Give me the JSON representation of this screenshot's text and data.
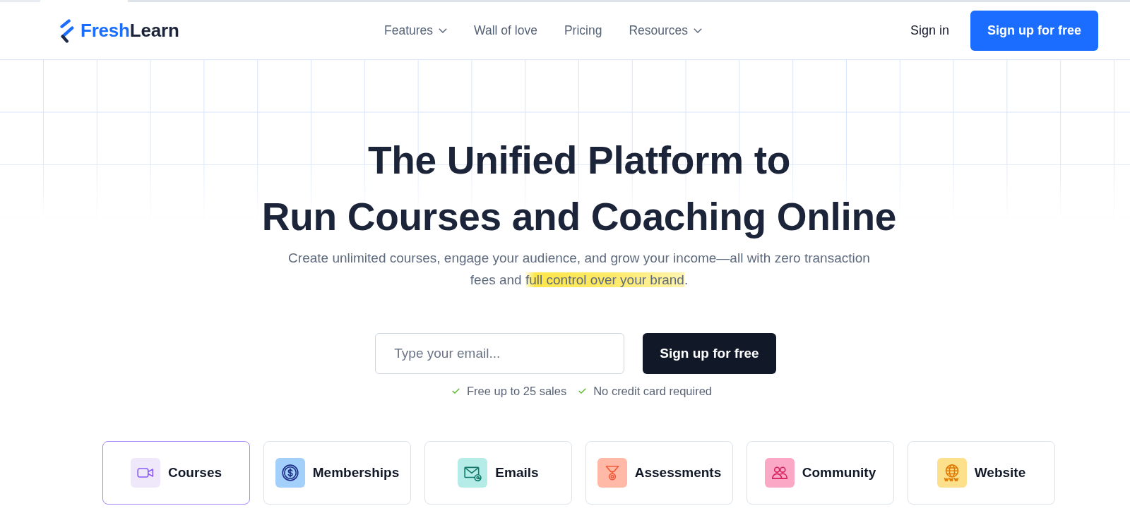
{
  "header": {
    "logo": {
      "first": "Fresh",
      "second": "Learn"
    },
    "nav": [
      {
        "label": "Features",
        "dropdown": true
      },
      {
        "label": "Wall of love",
        "dropdown": false
      },
      {
        "label": "Pricing",
        "dropdown": false
      },
      {
        "label": "Resources",
        "dropdown": true
      }
    ],
    "sign_in": "Sign in",
    "cta": "Sign up for free"
  },
  "hero": {
    "headline": [
      "The Unified Platform to",
      "Run Courses and Coaching Online"
    ],
    "subtitle": {
      "lines": [
        "Create unlimited courses, engage your audience, and grow your income—all with zero transaction",
        "fees and "
      ],
      "highlight": "full control over your brand",
      "end": "."
    }
  },
  "signup": {
    "placeholder": "Type your email...",
    "button": "Sign up for free",
    "perks": [
      "Free up to 25 sales",
      "No credit card required"
    ]
  },
  "features": [
    {
      "kind": "courses",
      "label": "Courses",
      "color": "#efe8fb",
      "selected": true
    },
    {
      "kind": "memberships",
      "label": "Memberships",
      "color": "#a3d0fb",
      "selected": false
    },
    {
      "kind": "emails",
      "label": "Emails",
      "color": "#b6ece7",
      "selected": false
    },
    {
      "kind": "assessments",
      "label": "Assessments",
      "color": "#ffb9a6",
      "selected": false
    },
    {
      "kind": "community",
      "label": "Community",
      "color": "#fba8c6",
      "selected": false
    },
    {
      "kind": "website",
      "label": "Website",
      "color": "#fde08c",
      "selected": false
    }
  ]
}
